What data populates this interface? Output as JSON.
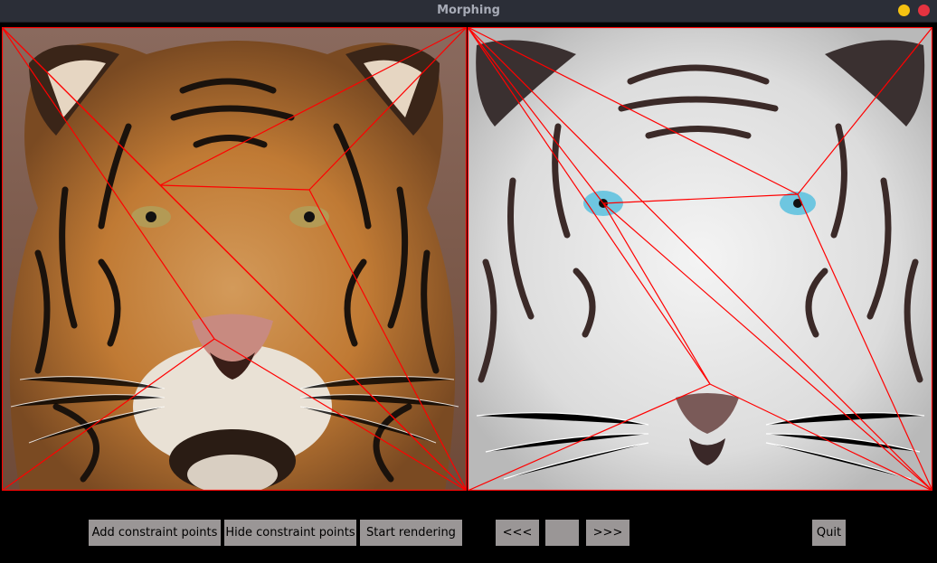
{
  "window": {
    "title": "Morphing"
  },
  "images": {
    "left": {
      "subject": "orange-tiger-photo"
    },
    "right": {
      "subject": "white-tiger-photo"
    }
  },
  "toolbar": {
    "add_constraint_points": "Add constraint points",
    "hide_constraint_points": "Hide constraint points",
    "start_rendering": "Start rendering",
    "prev": "<<<",
    "frame_value": "",
    "next": ">>>",
    "quit": "Quit"
  },
  "colors": {
    "titlebar": "#2b2e37",
    "title_text": "#a7abb6",
    "button_bg": "#9a9696",
    "constraint_lines": "#ff0000",
    "minimize": "#f5c211",
    "close": "#e53340"
  }
}
